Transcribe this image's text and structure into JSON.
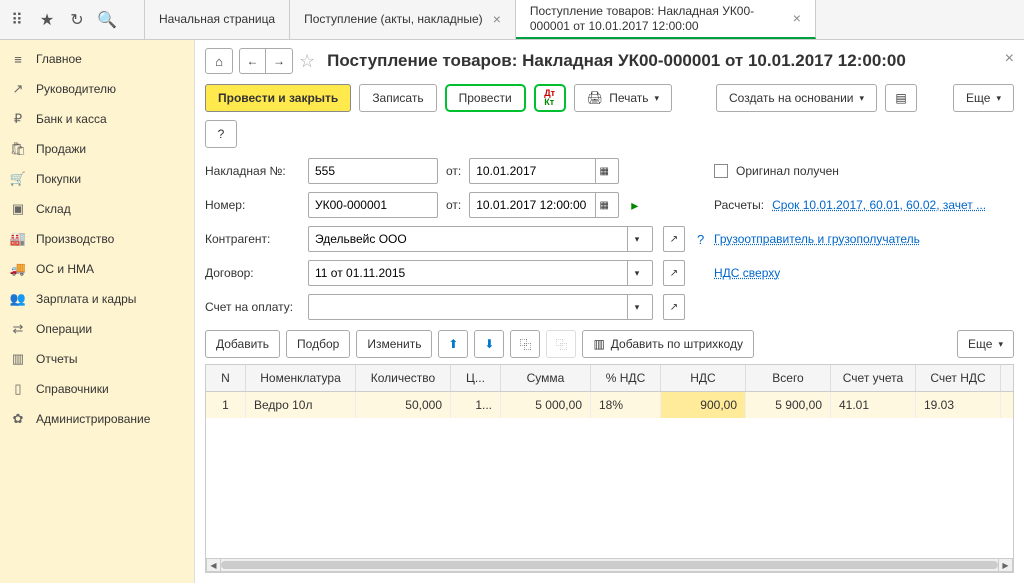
{
  "topbar_icons": [
    "apps-icon",
    "star-icon",
    "history-icon",
    "search-icon"
  ],
  "tabs": [
    {
      "label": "Начальная страница",
      "closable": false,
      "active": false
    },
    {
      "label": "Поступление (акты, накладные)",
      "closable": true,
      "active": false
    },
    {
      "label": "Поступление товаров: Накладная УК00-000001 от 10.01.2017 12:00:00",
      "closable": true,
      "active": true
    }
  ],
  "sidebar": [
    {
      "icon": "≡",
      "label": "Главное"
    },
    {
      "icon": "↗",
      "label": "Руководителю"
    },
    {
      "icon": "₽",
      "label": "Банк и касса"
    },
    {
      "icon": "🛍",
      "label": "Продажи"
    },
    {
      "icon": "🛒",
      "label": "Покупки"
    },
    {
      "icon": "▣",
      "label": "Склад"
    },
    {
      "icon": "🏭",
      "label": "Производство"
    },
    {
      "icon": "🚚",
      "label": "ОС и НМА"
    },
    {
      "icon": "👥",
      "label": "Зарплата и кадры"
    },
    {
      "icon": "⇄",
      "label": "Операции"
    },
    {
      "icon": "▥",
      "label": "Отчеты"
    },
    {
      "icon": "▯",
      "label": "Справочники"
    },
    {
      "icon": "✿",
      "label": "Администрирование"
    }
  ],
  "page_title": "Поступление товаров: Накладная УК00-000001 от 10.01.2017 12:00:00",
  "toolbar": {
    "post_close": "Провести и закрыть",
    "save": "Записать",
    "post": "Провести",
    "print": "Печать",
    "create_based": "Создать на основании",
    "more": "Еще"
  },
  "form": {
    "invoice_label": "Накладная №:",
    "invoice_no": "555",
    "from_label": "от:",
    "invoice_date": "10.01.2017",
    "original_label": "Оригинал получен",
    "number_label": "Номер:",
    "number": "УК00-000001",
    "datetime": "10.01.2017 12:00:00",
    "payments_label": "Расчеты:",
    "payments_link": "Срок 10.01.2017, 60.01, 60.02, зачет ...",
    "counterparty_label": "Контрагент:",
    "counterparty": "Эдельвейс ООО",
    "shipper_link": "Грузоотправитель и грузополучатель",
    "contract_label": "Договор:",
    "contract": "11 от 01.11.2015",
    "vat_link": "НДС сверху",
    "invoice_for_label": "Счет на оплату:"
  },
  "row_toolbar": {
    "add": "Добавить",
    "pick": "Подбор",
    "edit": "Изменить",
    "barcode": "Добавить по штрихкоду",
    "more": "Еще"
  },
  "table": {
    "headers": [
      "N",
      "Номенклатура",
      "Количество",
      "Ц...",
      "Сумма",
      "% НДС",
      "НДС",
      "Всего",
      "Счет учета",
      "Счет НДС"
    ],
    "row": {
      "n": "1",
      "nom": "Ведро 10л",
      "qty": "50,000",
      "price": "1...",
      "sum": "5 000,00",
      "vatp": "18%",
      "vat": "900,00",
      "total": "5 900,00",
      "acc": "41.01",
      "vacc": "19.03"
    }
  }
}
